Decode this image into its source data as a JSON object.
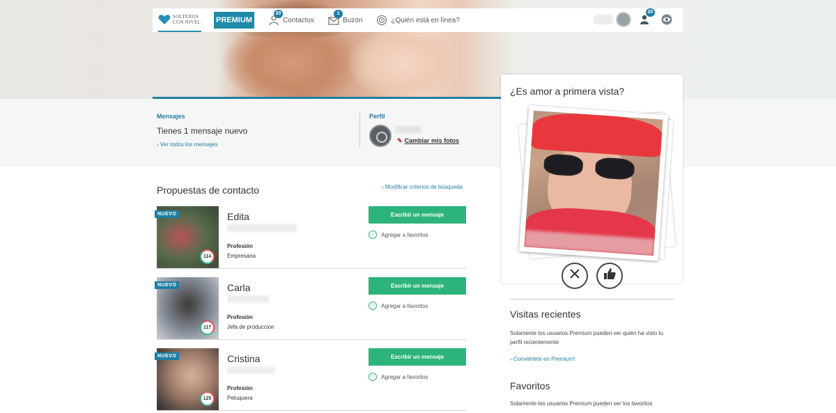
{
  "nav": {
    "logo_line1": "SOLTEROS",
    "logo_line2": "CON NIVEL",
    "premium": "PREMIUM",
    "contacts_label": "Contactos",
    "contacts_badge": "20",
    "inbox_label": "Buzón",
    "inbox_badge": "1",
    "online_label": "¿Quién está en línea?",
    "visits_badge": "20"
  },
  "messages": {
    "heading": "Mensajes",
    "text": "Tienes 1 mensaje nuevo",
    "link": "Ver todos los mensajes"
  },
  "profile": {
    "heading": "Perfil",
    "link": "Cambiar mis fotos"
  },
  "proposals": {
    "title": "Propuestas de contacto",
    "modify_link": "Modificar criterios de búsqueda",
    "new_badge": "NUEVO",
    "profession_label": "Profesión",
    "write_button": "Escribir un mensaje",
    "favorite_label": "Agregar a favoritos",
    "items": [
      {
        "name": "Edita",
        "score": "114",
        "profession": "Empresaria"
      },
      {
        "name": "Carla",
        "score": "117",
        "profession": "Jefa de produccion"
      },
      {
        "name": "Cristina",
        "score": "125",
        "profession": "Peluquera"
      }
    ]
  },
  "match": {
    "title": "¿Es amor a primera vista?"
  },
  "recent_visits": {
    "title": "Visitas recientes",
    "text": "Solamente los usuarios Premium pueden ver quién ha visto tu perfil recientemente",
    "link": "Conviértete en Premium!"
  },
  "favorites": {
    "title": "Favoritos",
    "text": "Solamente los usuarios Premium pueden ver los favoritos"
  },
  "colors": {
    "brand_blue": "#1f7ea3",
    "action_green": "#2db37c",
    "accent_red": "#e05757"
  }
}
